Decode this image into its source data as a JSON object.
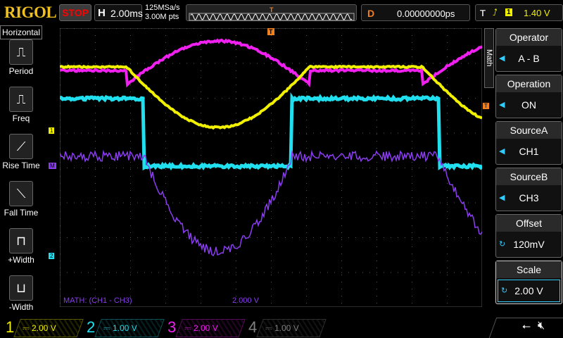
{
  "header": {
    "logo": "RIGOL",
    "run_state": "STOP",
    "h_label": "H",
    "timebase": "2.00ms",
    "sample_rate": "125MSa/s",
    "mem_depth": "3.00M pts",
    "d_label": "D",
    "delay": "0.00000000ps",
    "t_label": "T",
    "trigger_source": "1",
    "trigger_level": "1.40 V"
  },
  "left_menu": {
    "title": "Horizontal",
    "items": [
      {
        "label": "Period",
        "icon": "period-icon"
      },
      {
        "label": "Freq",
        "icon": "freq-icon"
      },
      {
        "label": "Rise Time",
        "icon": "rise-time-icon"
      },
      {
        "label": "Fall Time",
        "icon": "fall-time-icon"
      },
      {
        "label": "+Width",
        "icon": "pos-width-icon"
      },
      {
        "label": "-Width",
        "icon": "neg-width-icon"
      }
    ]
  },
  "right_menu": {
    "tab": "Math",
    "items": [
      {
        "title": "Operator",
        "value": "A - B"
      },
      {
        "title": "Operation",
        "value": "ON"
      },
      {
        "title": "SourceA",
        "value": "CH1"
      },
      {
        "title": "SourceB",
        "value": "CH3"
      },
      {
        "title": "Offset",
        "value": "120mV"
      },
      {
        "title": "Scale",
        "value": "2.00 V"
      }
    ]
  },
  "screen": {
    "math_label": "MATH: (CH1 - CH3)",
    "math_scale": "2.000 V",
    "marker_ch1": "1",
    "marker_ch2": "2",
    "marker_math": "M",
    "marker_trigger": "T"
  },
  "channels": [
    {
      "num": "1",
      "scale": "2.00 V",
      "color": "#f0f000"
    },
    {
      "num": "2",
      "scale": "1.00 V",
      "color": "#20e0f0"
    },
    {
      "num": "3",
      "scale": "2.00 V",
      "color": "#f020f0"
    },
    {
      "num": "4",
      "scale": "1.00 V",
      "color": "#808080"
    }
  ],
  "colors": {
    "ch1": "#f0f000",
    "ch2": "#20e0f0",
    "ch3": "#f020f0",
    "math": "#8a3cf0",
    "accent": "#f08020"
  }
}
